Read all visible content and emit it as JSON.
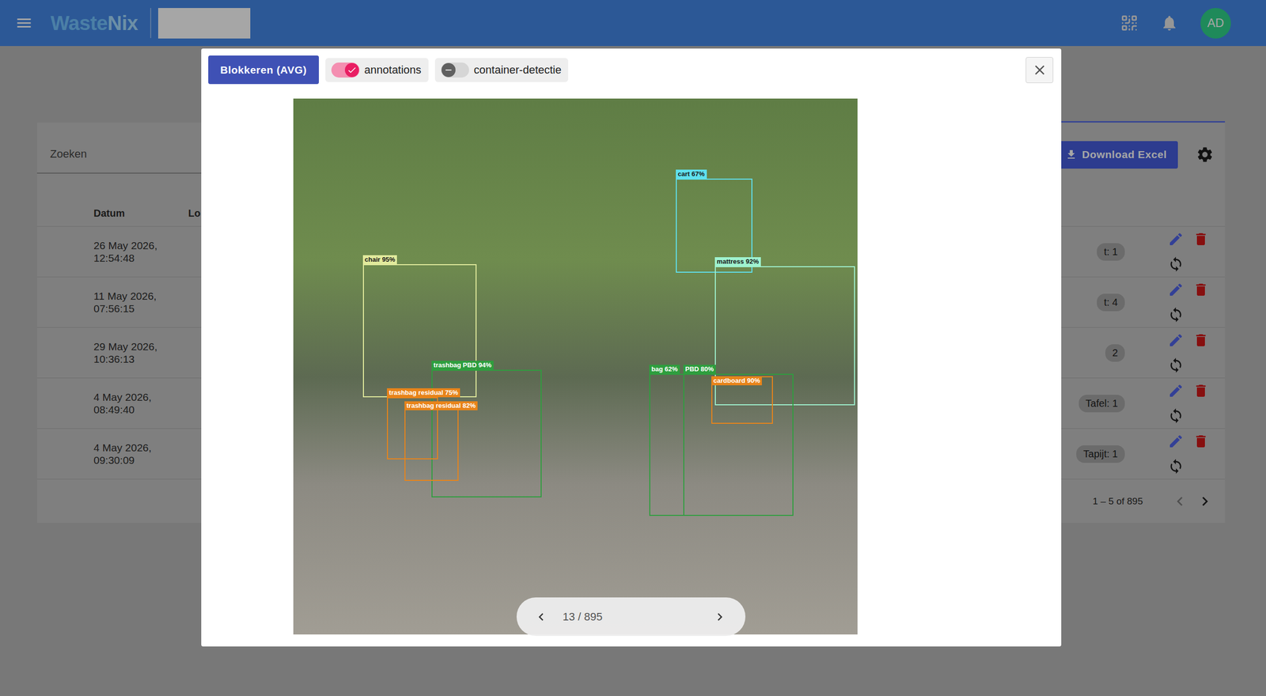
{
  "app_bar": {
    "logo": [
      "Waste",
      "Nix"
    ],
    "avatar": "AD"
  },
  "page": {
    "search": {
      "placeholder": "Zoeken"
    },
    "download_button": "Download Excel",
    "table": {
      "columns": [
        "Datum",
        "Lo"
      ],
      "rows": [
        {
          "date": "26 May 2026,",
          "time": "12:54:48",
          "tags": [
            "t: 1"
          ]
        },
        {
          "date": "11 May 2026,",
          "time": "07:56:15",
          "tags": [
            "t: 4"
          ]
        },
        {
          "date": "29 May 2026,",
          "time": "10:36:13",
          "tags": [
            "2"
          ]
        },
        {
          "date": "4 May 2026,",
          "time": "08:49:40",
          "tags": [
            "Tafel: 1"
          ]
        },
        {
          "date": "4 May 2026,",
          "time": "09:30:09",
          "tags": [
            "Tapijt: 1"
          ]
        }
      ]
    },
    "pagination": {
      "range": "1 – 5 of 895",
      "prev_disabled": true,
      "next_disabled": false
    }
  },
  "dialog": {
    "block_button": "Blokkeren (AVG)",
    "toggles": [
      {
        "label": "annotations",
        "on": true
      },
      {
        "label": "container-detectie",
        "on": false
      }
    ],
    "annotations": [
      {
        "label": "cart 67%",
        "color": "#5fe0ee"
      },
      {
        "label": "mattress 92%",
        "color": "#9ff2cf"
      },
      {
        "label": "chair 95%",
        "color": "#e1ea9c"
      },
      {
        "label": "trashbag PBD 94%",
        "color": "#2e9e3e"
      },
      {
        "label": "trashbag residual 75%",
        "color": "#e8841a"
      },
      {
        "label": "trashbag residual 82%",
        "color": "#e8841a"
      },
      {
        "label": "bag 62%",
        "color": "#2e9e3e"
      },
      {
        "label": "PBD 80%",
        "color": "#2e9e3e"
      },
      {
        "label": "cardboard 90%",
        "color": "#e8841a"
      }
    ],
    "pager": {
      "position": "13 / 895"
    }
  }
}
